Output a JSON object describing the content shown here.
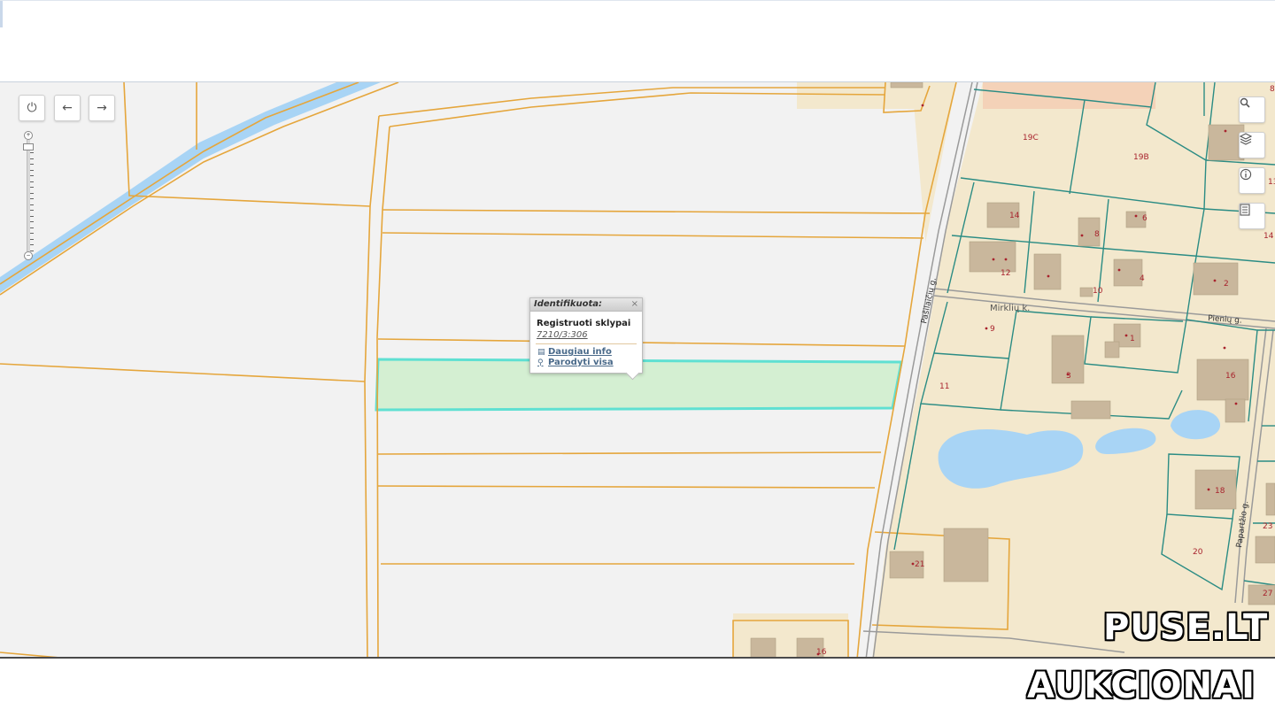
{
  "map": {
    "toolbar": {
      "power_icon": "power-icon",
      "back_icon": "arrow-left-icon",
      "forward_icon": "arrow-right-icon"
    },
    "right_tools": [
      "search-icon",
      "layers-icon",
      "info-icon",
      "document-icon"
    ],
    "streets": {
      "pasiliaiciu": "Pašilaičių g.",
      "pieniu": "Pienių g.",
      "mirkliu": "Mirklių k.",
      "papartzio": "Papartžio g."
    },
    "labels": {
      "p19c": "19C",
      "p19b": "19B",
      "p14": "14",
      "p8": "8",
      "p6": "6",
      "p14b": "14",
      "p12": "12",
      "p4": "4",
      "p2": "2",
      "p10": "10",
      "p9": "9",
      "p1": "1",
      "p3": "3",
      "p16": "16",
      "p11": "11",
      "p18": "18",
      "p20": "20",
      "p21": "21",
      "p23": "23",
      "p27": "27",
      "p16b": "16",
      "p13": "13",
      "p8b": "8"
    },
    "colors": {
      "parcel_line": "#e5a63c",
      "cadastral_line": "#2b8c84",
      "selected_fill": "#d4efd2",
      "selected_stroke": "#5fe0d2",
      "water": "#a8d4f5",
      "yard": "#f3e8cd",
      "building": "#c9b79c",
      "label": "#a8232d"
    }
  },
  "popup": {
    "header": "Identifikuota:",
    "close": "×",
    "title": "Registruoti sklypai",
    "code": "7210/3:306",
    "more_info": "Daugiau info",
    "show_all": "Parodyti visa"
  },
  "watermark": {
    "line1": "PUSE.LT",
    "line2": "AUKCIONAI"
  }
}
